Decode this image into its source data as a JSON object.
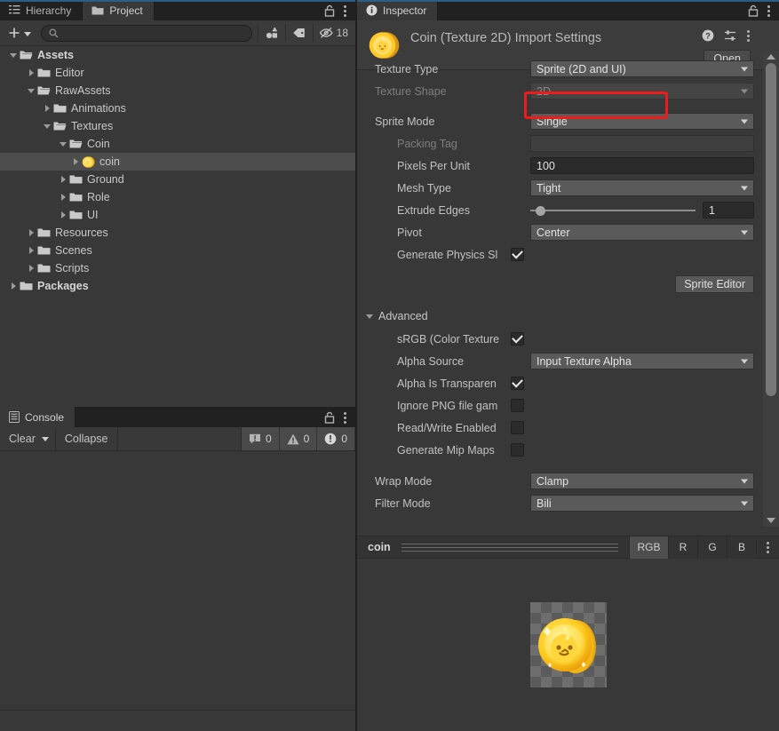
{
  "project_panel": {
    "tabs": [
      {
        "label": "Hierarchy",
        "icon": "hierarchy-icon",
        "active": false
      },
      {
        "label": "Project",
        "icon": "folder-icon",
        "active": true
      }
    ],
    "lock_icon": "lock-icon",
    "menu_icon": "kebab-menu-icon",
    "toolbar": {
      "add_label": "+",
      "add_dropdown_icon": "chevron-down-icon",
      "search_icon": "search-icon",
      "search_value": "",
      "search_placeholder": "",
      "filter_by_type_icon": "filter-by-type-icon",
      "filter_by_label_icon": "tag-icon",
      "hidden_icon": "eye-crossed-icon",
      "hidden_count": "18"
    },
    "tree": [
      {
        "label": "Assets",
        "depth": 0,
        "expanded": true,
        "open_folder": true,
        "bold": true,
        "icon": "folder-open-icon",
        "selected": false
      },
      {
        "label": "Editor",
        "depth": 1,
        "expanded": false,
        "open_folder": false,
        "bold": false,
        "icon": "folder-icon",
        "selected": false
      },
      {
        "label": "RawAssets",
        "depth": 1,
        "expanded": true,
        "open_folder": true,
        "bold": false,
        "icon": "folder-open-icon",
        "selected": false
      },
      {
        "label": "Animations",
        "depth": 2,
        "expanded": false,
        "open_folder": false,
        "bold": false,
        "icon": "folder-icon",
        "selected": false
      },
      {
        "label": "Textures",
        "depth": 2,
        "expanded": true,
        "open_folder": true,
        "bold": false,
        "icon": "folder-open-icon",
        "selected": false
      },
      {
        "label": "Coin",
        "depth": 3,
        "expanded": true,
        "open_folder": true,
        "bold": false,
        "icon": "folder-open-icon",
        "selected": false
      },
      {
        "label": "coin",
        "depth": 4,
        "expanded": false,
        "open_folder": false,
        "bold": false,
        "icon": "coin-texture-icon",
        "selected": true
      },
      {
        "label": "Ground",
        "depth": 3,
        "expanded": false,
        "open_folder": false,
        "bold": false,
        "icon": "folder-icon",
        "selected": false
      },
      {
        "label": "Role",
        "depth": 3,
        "expanded": false,
        "open_folder": false,
        "bold": false,
        "icon": "folder-icon",
        "selected": false
      },
      {
        "label": "UI",
        "depth": 3,
        "expanded": false,
        "open_folder": false,
        "bold": false,
        "icon": "folder-icon",
        "selected": false
      },
      {
        "label": "Resources",
        "depth": 1,
        "expanded": false,
        "open_folder": false,
        "bold": false,
        "icon": "folder-icon",
        "selected": false
      },
      {
        "label": "Scenes",
        "depth": 1,
        "expanded": false,
        "open_folder": false,
        "bold": false,
        "icon": "folder-icon",
        "selected": false
      },
      {
        "label": "Scripts",
        "depth": 1,
        "expanded": false,
        "open_folder": false,
        "bold": false,
        "icon": "folder-icon",
        "selected": false
      },
      {
        "label": "Packages",
        "depth": 0,
        "expanded": false,
        "open_folder": false,
        "bold": true,
        "icon": "folder-icon",
        "selected": false
      }
    ]
  },
  "console_panel": {
    "tab_label": "Console",
    "tab_icon": "console-icon",
    "lock_icon": "lock-icon",
    "menu_icon": "kebab-menu-icon",
    "clear_label": "Clear",
    "clear_dropdown_icon": "chevron-down-icon",
    "collapse_label": "Collapse",
    "counters": [
      {
        "icon": "log-icon",
        "count": "0"
      },
      {
        "icon": "warning-icon",
        "count": "0"
      },
      {
        "icon": "error-icon",
        "count": "0"
      }
    ]
  },
  "inspector": {
    "tab_label": "Inspector",
    "tab_icon": "info-icon",
    "lock_icon": "lock-icon",
    "menu_icon": "kebab-menu-icon",
    "asset_icon": "coin-texture-icon",
    "title": "Coin (Texture 2D) Import Settings",
    "help_icon": "help-icon",
    "preset_icon": "preset-icon",
    "header_menu_icon": "kebab-menu-icon",
    "open_button": "Open",
    "highlight_color": "#ee1b1b",
    "fields": {
      "texture_type": {
        "label": "Texture Type",
        "value": "Sprite (2D and UI)",
        "highlighted": true
      },
      "texture_shape": {
        "label": "Texture Shape",
        "value": "2D",
        "disabled": true
      },
      "sprite_mode": {
        "label": "Sprite Mode",
        "value": "Single"
      },
      "packing_tag": {
        "label": "Packing Tag",
        "value": "",
        "disabled": true
      },
      "pixels_per_unit": {
        "label": "Pixels Per Unit",
        "value": "100"
      },
      "mesh_type": {
        "label": "Mesh Type",
        "value": "Tight"
      },
      "extrude_edges": {
        "label": "Extrude Edges",
        "value": "1",
        "slider_percent": 3
      },
      "pivot": {
        "label": "Pivot",
        "value": "Center"
      },
      "generate_physics_shape": {
        "label": "Generate Physics Sl",
        "checked": true
      },
      "sprite_editor_button": "Sprite Editor"
    },
    "advanced": {
      "label": "Advanced",
      "expanded": true,
      "srgb": {
        "label": "sRGB (Color Texture",
        "checked": true
      },
      "alpha_source": {
        "label": "Alpha Source",
        "value": "Input Texture Alpha"
      },
      "alpha_is_transparency": {
        "label": "Alpha Is Transparen",
        "checked": true
      },
      "ignore_png_gamma": {
        "label": "Ignore PNG file gam",
        "checked": false
      },
      "read_write_enabled": {
        "label": "Read/Write Enabled",
        "checked": false
      },
      "generate_mip_maps": {
        "label": "Generate Mip Maps",
        "checked": false
      }
    },
    "wrap_mode": {
      "label": "Wrap Mode",
      "value": "Clamp"
    },
    "filter_mode": {
      "label": "Filter Mode",
      "value": "Bili"
    },
    "preview": {
      "name": "coin",
      "drag_handle_icon": "drag-handle-icon",
      "channels": [
        {
          "label": "RGB",
          "active": true
        },
        {
          "label": "R",
          "active": false
        },
        {
          "label": "G",
          "active": false
        },
        {
          "label": "B",
          "active": false
        }
      ],
      "menu_icon": "kebab-menu-icon",
      "image_alt": "coin-sprite-preview"
    }
  }
}
